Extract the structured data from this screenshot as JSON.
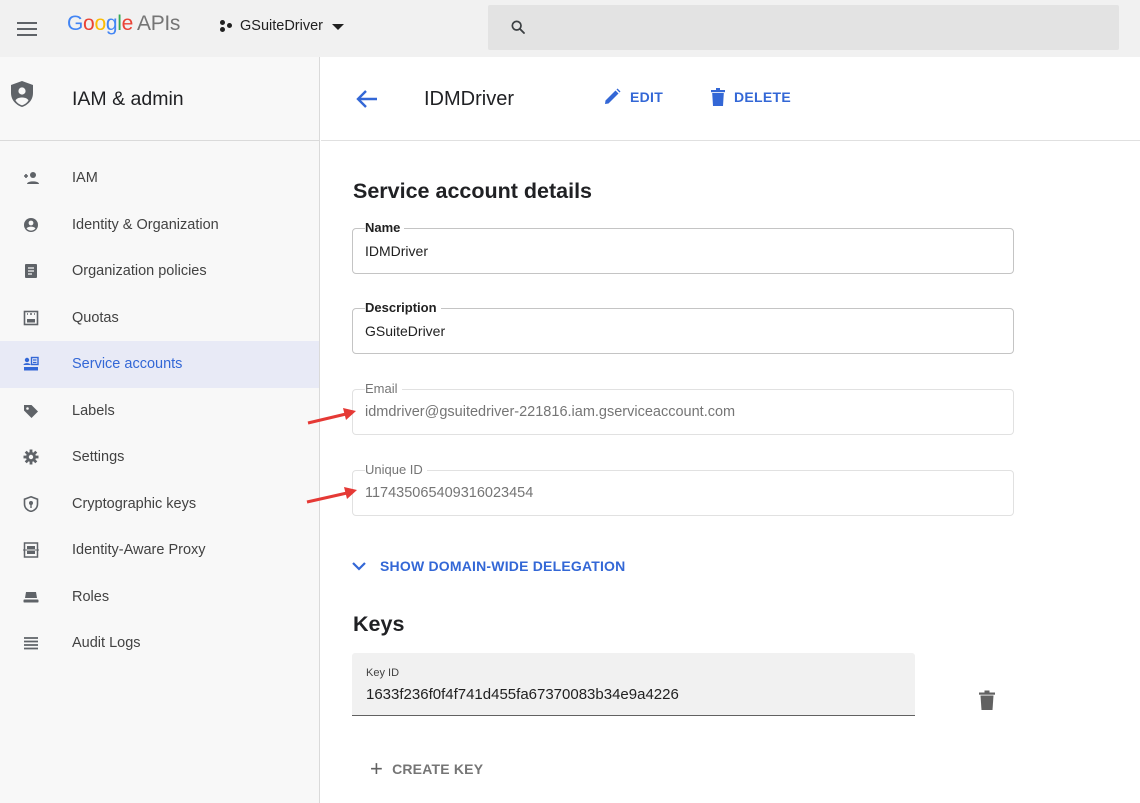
{
  "topbar": {
    "logo_letters": [
      "G",
      "o",
      "o",
      "g",
      "l",
      "e"
    ],
    "logo_suffix": "APIs",
    "project_name": "GSuiteDriver"
  },
  "sidebar": {
    "title": "IAM & admin",
    "items": [
      {
        "label": "IAM",
        "icon": "person-add-icon"
      },
      {
        "label": "Identity & Organization",
        "icon": "account-circle-icon"
      },
      {
        "label": "Organization policies",
        "icon": "document-icon"
      },
      {
        "label": "Quotas",
        "icon": "quota-icon"
      },
      {
        "label": "Service accounts",
        "icon": "service-account-icon",
        "active": true
      },
      {
        "label": "Labels",
        "icon": "label-icon"
      },
      {
        "label": "Settings",
        "icon": "gear-icon"
      },
      {
        "label": "Cryptographic keys",
        "icon": "security-key-icon"
      },
      {
        "label": "Identity-Aware Proxy",
        "icon": "proxy-icon"
      },
      {
        "label": "Roles",
        "icon": "roles-icon"
      },
      {
        "label": "Audit Logs",
        "icon": "list-icon"
      }
    ]
  },
  "header": {
    "title": "IDMDriver",
    "edit_label": "EDIT",
    "delete_label": "DELETE"
  },
  "details": {
    "section_title": "Service account details",
    "name_label": "Name",
    "name_value": "IDMDriver",
    "description_label": "Description",
    "description_value": "GSuiteDriver",
    "email_label": "Email",
    "email_value": "idmdriver@gsuitedriver-221816.iam.gserviceaccount.com",
    "unique_id_label": "Unique ID",
    "unique_id_value": "117435065409316023454",
    "delegation_label": "SHOW DOMAIN-WIDE DELEGATION"
  },
  "keys": {
    "section_title": "Keys",
    "key_id_label": "Key ID",
    "key_id_value": "1633f236f0f4f741d455fa67370083b34e9a4226",
    "create_label": "CREATE KEY"
  },
  "colors": {
    "accent": "#3367d6",
    "annotation_arrow": "#e53935"
  }
}
